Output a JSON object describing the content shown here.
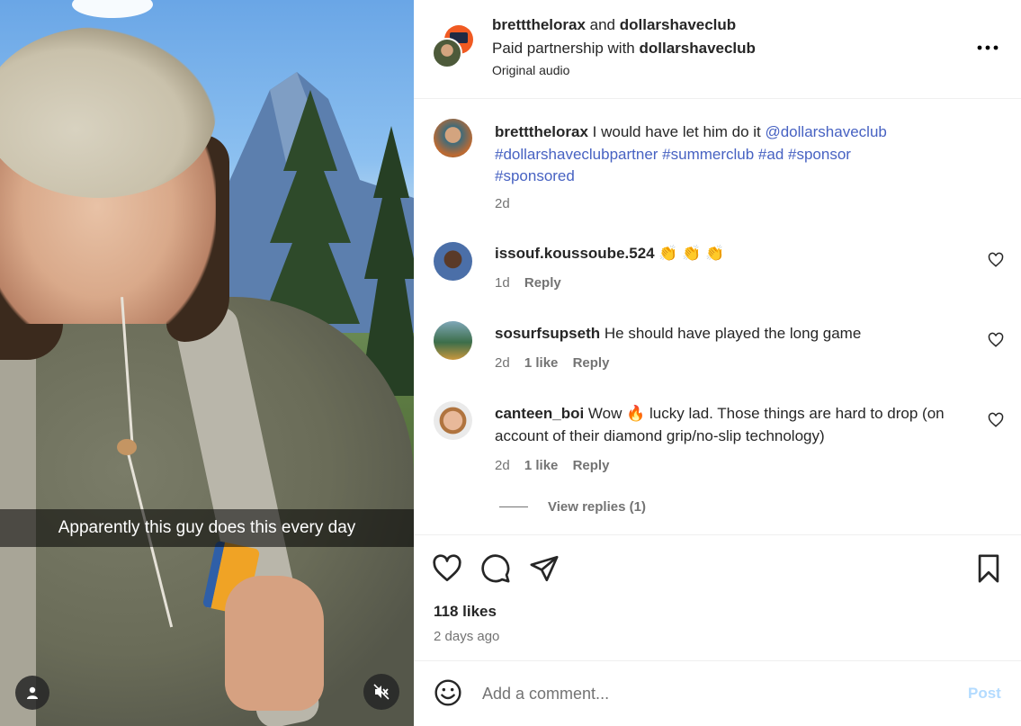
{
  "video": {
    "caption": "Apparently this guy does this every day",
    "user_icon": "user-icon",
    "mute_icon": "speaker-muted-icon"
  },
  "header": {
    "author": "brettthelorax",
    "and_text": " and ",
    "collaborator": "dollarshaveclub",
    "partnership_prefix": "Paid partnership with ",
    "partnership_brand": "dollarshaveclub",
    "audio": "Original audio",
    "more_icon": "more-options-icon"
  },
  "caption_post": {
    "user": "brettthelorax",
    "text": " I would have let him do it ",
    "mention": "@dollarshaveclub",
    "hashtags_line2": "#dollarshaveclubpartner #summerclub #ad #sponsor",
    "hashtags_line3": "#sponsored",
    "time": "2d"
  },
  "comments": [
    {
      "user": "issouf.koussoube.524",
      "text": " 👏 👏 👏",
      "time": "1d",
      "likes": "",
      "reply": "Reply"
    },
    {
      "user": "sosurfsupseth",
      "text": " He should have played the long game",
      "time": "2d",
      "likes": "1 like",
      "reply": "Reply"
    },
    {
      "user": "canteen_boi",
      "text": " Wow 🔥 lucky lad. Those things are hard to drop (on account of their diamond grip/no-slip technology)",
      "time": "2d",
      "likes": "1 like",
      "reply": "Reply"
    }
  ],
  "view_replies": "View replies (1)",
  "actions": {
    "like_icon": "heart-icon",
    "comment_icon": "comment-icon",
    "share_icon": "send-icon",
    "save_icon": "bookmark-icon"
  },
  "likes": "118 likes",
  "posted_ago": "2 days ago",
  "composer": {
    "emoji_icon": "emoji-icon",
    "placeholder": "Add a comment...",
    "post_label": "Post"
  },
  "colors": {
    "link": "#4762c2",
    "muted": "#737373",
    "post_disabled": "#b3dbff"
  }
}
